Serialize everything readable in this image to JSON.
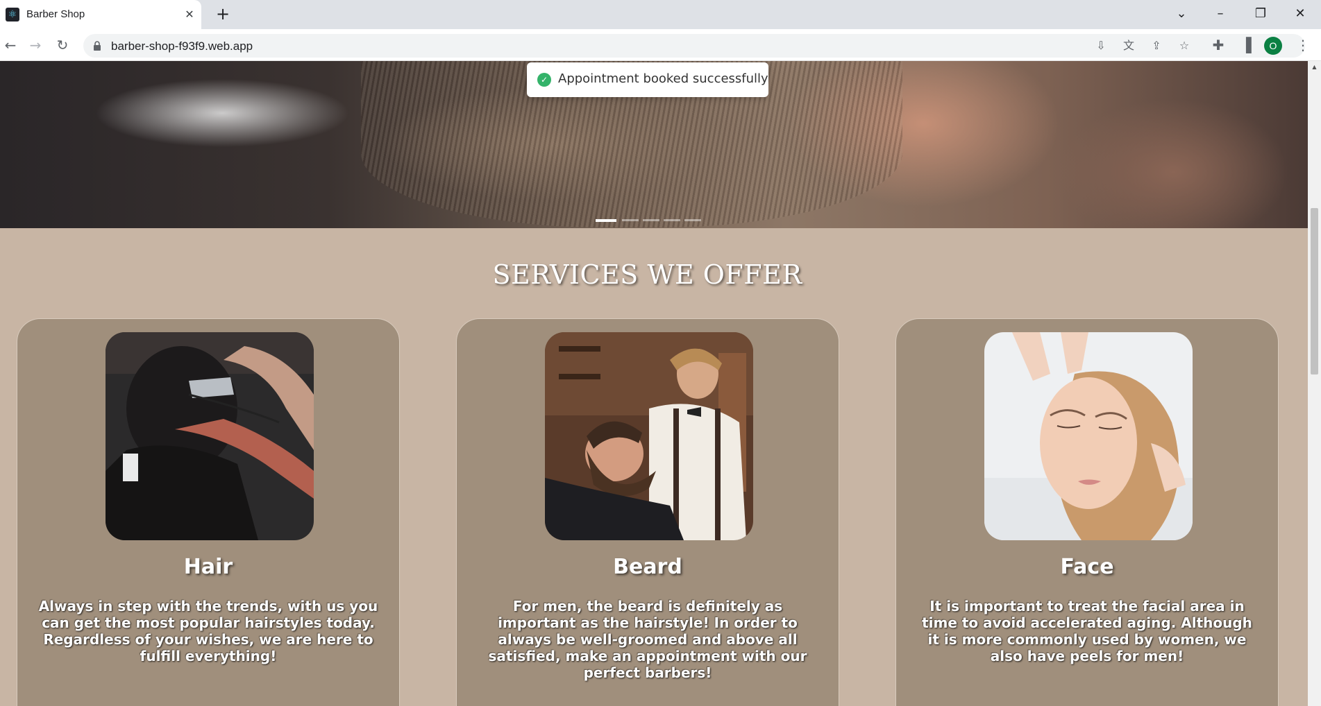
{
  "browser": {
    "tab_title": "Barber Shop",
    "url": "barber-shop-f93f9.web.app",
    "profile_initial": "O",
    "icons": {
      "favicon": "react-icon",
      "close": "close-icon",
      "new_tab": "plus-icon",
      "back": "back-arrow-icon",
      "forward": "forward-arrow-icon",
      "reload": "reload-icon",
      "lock": "lock-icon",
      "install": "install-icon",
      "translate": "translate-icon",
      "share": "share-icon",
      "bookmark": "star-icon",
      "extensions": "puzzle-icon",
      "sidebar": "sidebar-icon",
      "menu": "kebab-menu-icon"
    }
  },
  "toast": {
    "message": "Appointment booked successfully",
    "status_color": "#34b36a"
  },
  "carousel": {
    "slide_count": 5,
    "active_index": 0
  },
  "services": {
    "heading": "SERVICES WE OFFER",
    "items": [
      {
        "title": "Hair",
        "description": "Always in step with the trends, with us you can get the most popular hairstyles today. Regardless of your wishes, we are here to fulfill everything!"
      },
      {
        "title": "Beard",
        "description": "For men, the beard is definitely as important as the hairstyle! In order to always be well-groomed and above all satisfied, make an appointment with our perfect barbers!"
      },
      {
        "title": "Face",
        "description": "It is important to treat the facial area in time to avoid accelerated aging. Although it is more commonly used by women, we also have peels for men!"
      }
    ]
  },
  "colors": {
    "page_background": "#c8b5a4",
    "card_background": "#a08f7c"
  }
}
